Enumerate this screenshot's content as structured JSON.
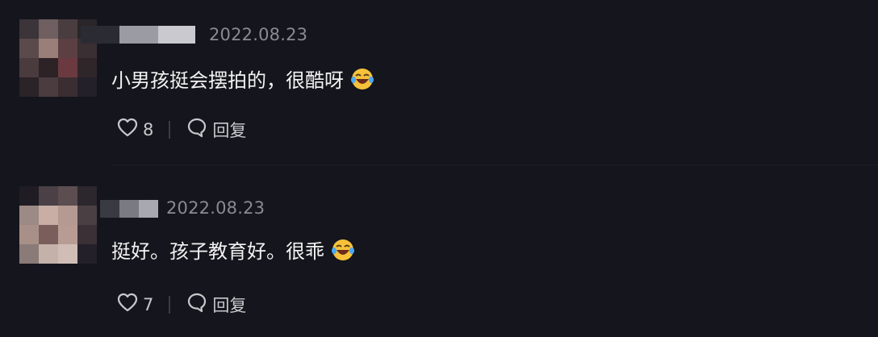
{
  "comments": [
    {
      "date": "2022.08.23",
      "text": "小男孩挺会摆拍的，很酷呀",
      "emoji": "laughing-crying-emoji",
      "likes": "8",
      "reply_label": "回复"
    },
    {
      "date": "2022.08.23",
      "text": "挺好。孩子教育好。很乖",
      "emoji": "laughing-crying-emoji",
      "likes": "7",
      "reply_label": "回复"
    }
  ],
  "colors": {
    "background": "#15151d",
    "text": "#f2f2f2",
    "meta": "#8a8a92",
    "action": "#c8c8cc"
  }
}
